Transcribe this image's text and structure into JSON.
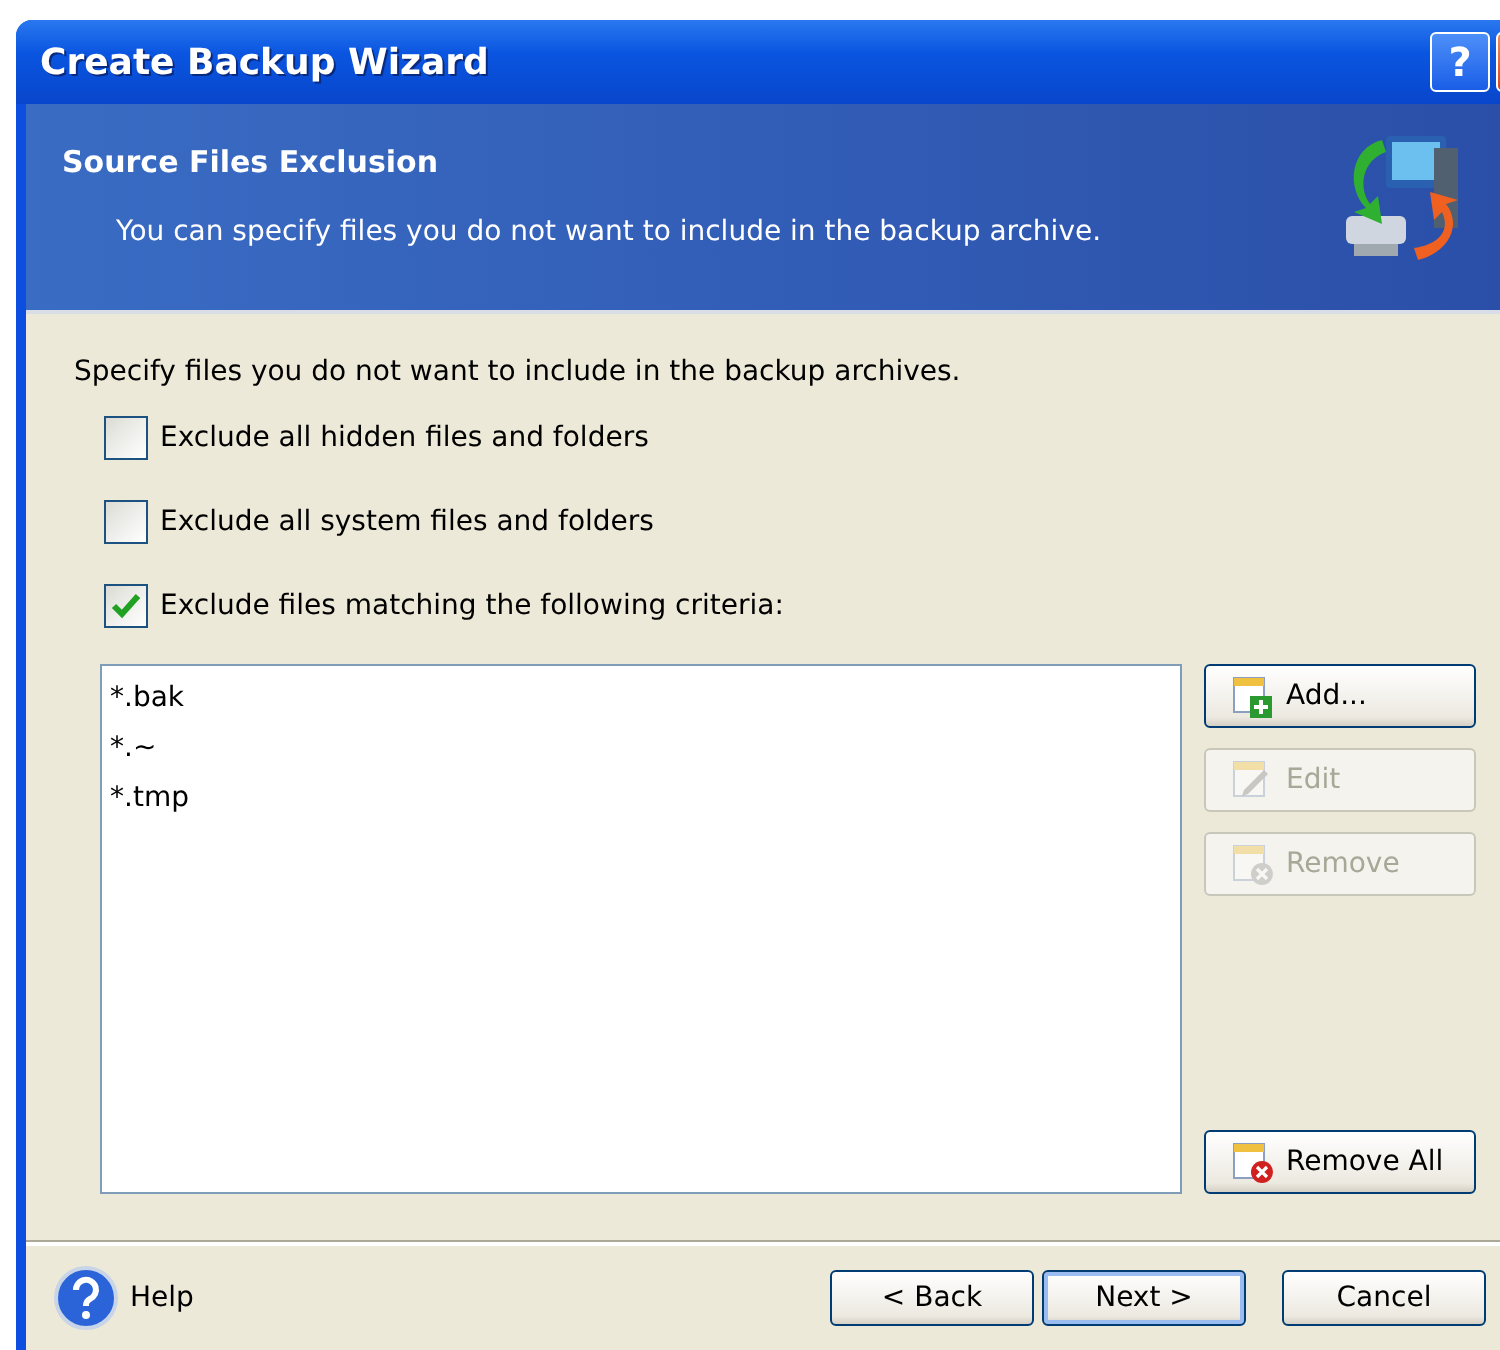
{
  "window": {
    "title": "Create Backup Wizard",
    "help_button": "?"
  },
  "header": {
    "title": "Source Files Exclusion",
    "subtitle": "You can specify files you do not want to include in the backup archive."
  },
  "instruction": "Specify files you do not want to include in the backup archives.",
  "options": [
    {
      "label": "Exclude all hidden files and folders",
      "checked": false
    },
    {
      "label": "Exclude all system files and folders",
      "checked": false
    },
    {
      "label": "Exclude files matching the following criteria:",
      "checked": true
    }
  ],
  "criteria": [
    "*.bak",
    "*.~",
    "*.tmp"
  ],
  "list_buttons": [
    {
      "kind": "add",
      "label": "Add...",
      "disabled": false
    },
    {
      "kind": "edit",
      "label": "Edit",
      "disabled": true
    },
    {
      "kind": "remove",
      "label": "Remove",
      "disabled": true
    },
    {
      "kind": "remove_all",
      "label": "Remove All",
      "disabled": false
    }
  ],
  "footer": {
    "help": "Help",
    "buttons": [
      {
        "label": "< Back",
        "default": false
      },
      {
        "label": "Next >",
        "default": true
      },
      {
        "label": "Cancel",
        "default": false
      }
    ]
  }
}
